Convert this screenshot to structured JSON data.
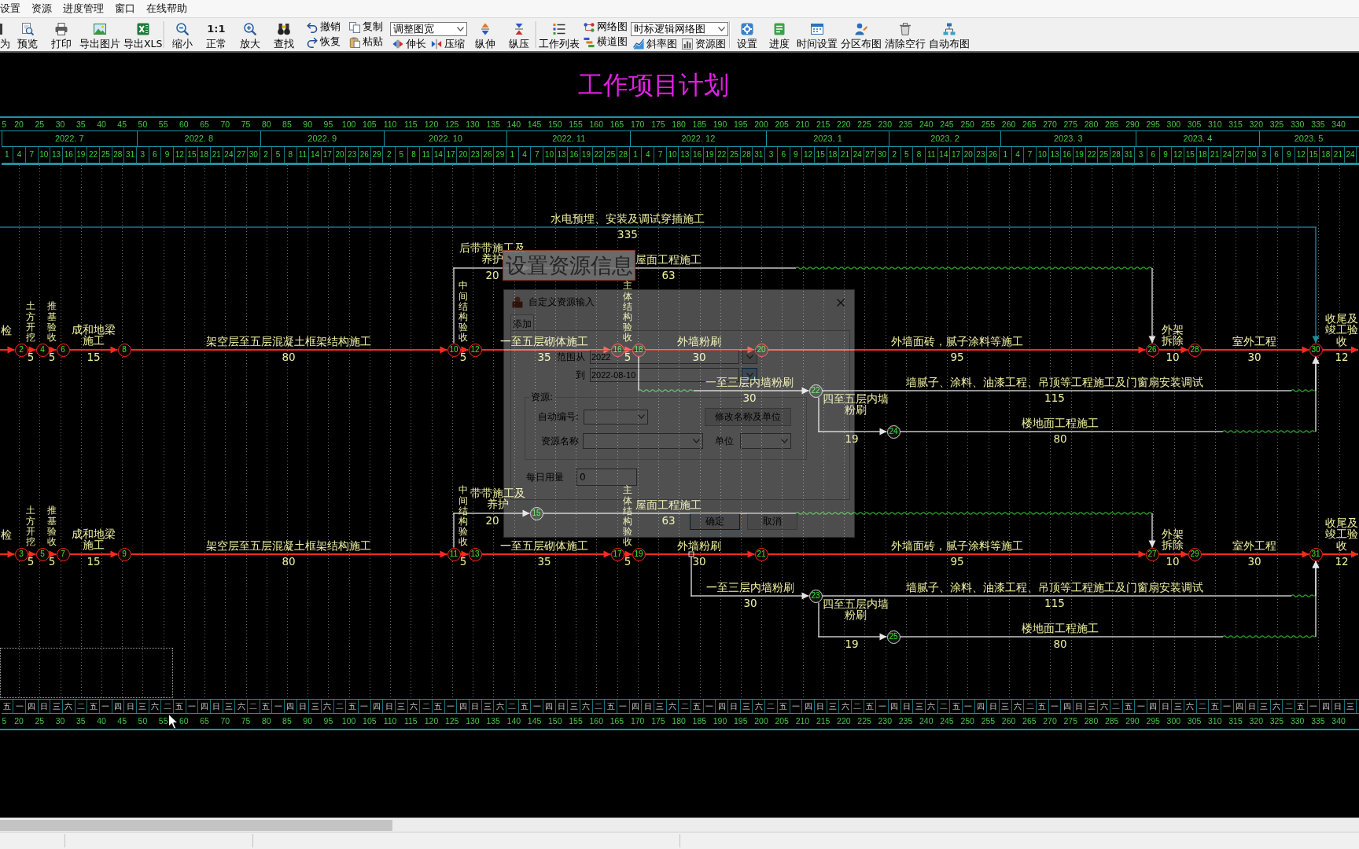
{
  "menu": [
    {
      "label": "设置"
    },
    {
      "label": "资源"
    },
    {
      "label": "进度管理"
    },
    {
      "label": "窗口"
    },
    {
      "label": "在线帮助"
    }
  ],
  "toolbar": [
    {
      "items": [
        {
          "kind": "large",
          "label": "为"
        },
        {
          "kind": "large",
          "label": "预览"
        },
        {
          "kind": "large",
          "label": "打印"
        },
        {
          "kind": "large",
          "label": "导出图片"
        },
        {
          "kind": "large",
          "label": "导出XLS"
        }
      ]
    },
    {
      "items": [
        {
          "kind": "large",
          "label": "缩小"
        },
        {
          "kind": "large",
          "label": "正常",
          "glyph": "1:1"
        },
        {
          "kind": "large",
          "label": "放大"
        },
        {
          "kind": "large",
          "label": "查找"
        },
        {
          "kind": "stack",
          "items": [
            {
              "label": "撤销"
            },
            {
              "label": "恢复"
            }
          ]
        },
        {
          "kind": "stack",
          "items": [
            {
              "label": "复制"
            },
            {
              "label": "粘贴"
            }
          ]
        },
        {
          "kind": "combo",
          "value": "调整图宽",
          "items": [
            {
              "label": "伸长"
            },
            {
              "label": "压缩"
            }
          ]
        },
        {
          "kind": "large",
          "label": "纵伸"
        },
        {
          "kind": "large",
          "label": "纵压"
        }
      ]
    },
    {
      "items": [
        {
          "kind": "large",
          "label": "工作列表"
        },
        {
          "kind": "stack",
          "items": [
            {
              "label": "网络图"
            },
            {
              "label": "横道图"
            }
          ]
        },
        {
          "kind": "combo",
          "value": "时标逻辑网络图",
          "items": [
            {
              "label": "斜率图"
            },
            {
              "label": "资源图"
            }
          ]
        }
      ]
    },
    {
      "items": [
        {
          "kind": "large",
          "label": "设置"
        },
        {
          "kind": "large",
          "label": "进度"
        },
        {
          "kind": "large",
          "label": "时间设置"
        },
        {
          "kind": "large",
          "label": "分区布图"
        },
        {
          "kind": "large",
          "label": "清除空行"
        },
        {
          "kind": "large",
          "label": "自动布图"
        }
      ]
    }
  ],
  "title": "工作项目计划",
  "top_scale": {
    "day_counts": [
      "5",
      "20",
      "25",
      "30",
      "35",
      "40",
      "45",
      "50",
      "55",
      "60",
      "65",
      "70",
      "75",
      "80",
      "85",
      "90",
      "95",
      "100",
      "105",
      "110",
      "115",
      "120",
      "125",
      "130",
      "135",
      "140",
      "145",
      "150",
      "155",
      "160",
      "165",
      "170",
      "175",
      "180",
      "185",
      "190",
      "195",
      "200",
      "205",
      "210",
      "215",
      "220",
      "225",
      "230",
      "235",
      "240",
      "245",
      "250",
      "255",
      "260",
      "265",
      "270",
      "275",
      "280",
      "285",
      "290",
      "295",
      "300",
      "305",
      "310",
      "315",
      "320",
      "325",
      "330",
      "335",
      "340"
    ],
    "months": [
      {
        "label": "2022. 7",
        "days": [
          "1",
          "4",
          "7",
          "10",
          "13",
          "16",
          "19",
          "22",
          "25",
          "28",
          "31"
        ]
      },
      {
        "label": "2022. 8",
        "days": [
          "3",
          "6",
          "9",
          "12",
          "15",
          "18",
          "21",
          "24",
          "27",
          "30"
        ]
      },
      {
        "label": "2022. 9",
        "days": [
          "2",
          "5",
          "8",
          "11",
          "14",
          "17",
          "20",
          "23",
          "26",
          "29"
        ]
      },
      {
        "label": "2022. 10",
        "days": [
          "2",
          "5",
          "8",
          "11",
          "14",
          "17",
          "20",
          "23",
          "26",
          "29"
        ]
      },
      {
        "label": "2022. 11",
        "days": [
          "1",
          "4",
          "7",
          "10",
          "13",
          "16",
          "19",
          "22",
          "25",
          "28"
        ]
      },
      {
        "label": "2022. 12",
        "days": [
          "1",
          "4",
          "7",
          "10",
          "13",
          "16",
          "19",
          "22",
          "25",
          "28",
          "31"
        ]
      },
      {
        "label": "2023. 1",
        "days": [
          "3",
          "6",
          "9",
          "12",
          "15",
          "18",
          "21",
          "24",
          "27",
          "30"
        ]
      },
      {
        "label": "2023. 2",
        "days": [
          "2",
          "5",
          "8",
          "11",
          "14",
          "17",
          "20",
          "23",
          "26"
        ]
      },
      {
        "label": "2023. 3",
        "days": [
          "1",
          "4",
          "7",
          "10",
          "13",
          "16",
          "19",
          "22",
          "25",
          "28",
          "31"
        ]
      },
      {
        "label": "2023. 4",
        "days": [
          "3",
          "6",
          "9",
          "12",
          "15",
          "18",
          "21",
          "24",
          "27",
          "30"
        ]
      },
      {
        "label": "2023. 5",
        "days": [
          "3",
          "6",
          "9",
          "12",
          "15",
          "18",
          "21",
          "24"
        ]
      }
    ]
  },
  "networks": [
    {
      "nodes": [
        {
          "number": "2",
          "critical": true
        },
        {
          "number": "4",
          "critical": true
        },
        {
          "number": "6",
          "critical": true
        },
        {
          "number": "8",
          "critical": true
        },
        {
          "number": "10",
          "critical": true
        },
        {
          "number": "12",
          "critical": true
        },
        {
          "number": "16",
          "critical": true
        },
        {
          "number": "18",
          "critical": true
        },
        {
          "number": "20",
          "critical": true
        },
        {
          "number": "26",
          "critical": true
        },
        {
          "number": "28",
          "critical": true
        },
        {
          "number": "30",
          "critical": true
        },
        {
          "critical": false
        },
        {
          "number": "22",
          "critical": false
        },
        {
          "number": "24",
          "critical": false
        }
      ],
      "activities": [
        {
          "name": "检",
          "kind": "critical"
        },
        {
          "name": "土方开挖",
          "duration": "5",
          "kind": "critical"
        },
        {
          "name": "推基验收",
          "duration": "5",
          "kind": "critical"
        },
        {
          "name": "成和地梁施工",
          "duration": "15",
          "kind": "critical"
        },
        {
          "name": "架空层至五层混凝土框架结构施工",
          "duration": "80",
          "kind": "critical"
        },
        {
          "name": "中间结构验收",
          "duration": "5",
          "kind": "critical"
        },
        {
          "name": "一至五层砌体施工",
          "duration": "35",
          "kind": "critical"
        },
        {
          "name": "主体结构验收",
          "duration": "5",
          "kind": "critical"
        },
        {
          "name": "外墙粉刷",
          "duration": "30",
          "kind": "critical"
        },
        {
          "name": "外墙面砖，腻子涂料等施工",
          "duration": "95",
          "kind": "critical"
        },
        {
          "name": "外架拆除",
          "duration": "10",
          "kind": "critical"
        },
        {
          "name": "室外工程",
          "duration": "30",
          "kind": "critical"
        },
        {
          "name": "收尾及竣工验收",
          "duration": "12",
          "kind": "critical"
        },
        {
          "name": "水电预埋、安装及调试穿插施工",
          "duration": "335",
          "kind": "span"
        },
        {
          "name": "后带带施工及养护",
          "duration": "20",
          "kind": "normal"
        },
        {
          "name": "屋面工程施工",
          "duration": "63",
          "kind": "normal"
        },
        {
          "name": "一至三层内墙粉刷",
          "duration": "30",
          "kind": "normal"
        },
        {
          "name": "墙腻子、涂料、油漆工程、吊顶等工程施工及门窗扇安装调试",
          "duration": "115",
          "kind": "normal"
        },
        {
          "name": "四至五层内墙粉刷",
          "duration": "19",
          "kind": "normal"
        },
        {
          "name": "楼地面工程施工",
          "duration": "80",
          "kind": "normal"
        }
      ]
    },
    {
      "nodes": [
        {
          "number": "3",
          "critical": true
        },
        {
          "number": "5",
          "critical": true
        },
        {
          "number": "7",
          "critical": true
        },
        {
          "number": "9",
          "critical": true
        },
        {
          "number": "11",
          "critical": true
        },
        {
          "number": "13",
          "critical": true
        },
        {
          "number": "17",
          "critical": true
        },
        {
          "number": "19",
          "critical": true
        },
        {
          "number": "21",
          "critical": true
        },
        {
          "number": "27",
          "critical": true
        },
        {
          "number": "29",
          "critical": true
        },
        {
          "number": "31",
          "critical": true
        },
        {
          "number": "15",
          "critical": false
        },
        {
          "number": "23",
          "critical": false
        },
        {
          "number": "25",
          "critical": false
        }
      ],
      "activities": [
        {
          "name": "检",
          "kind": "critical"
        },
        {
          "name": "土方开挖",
          "duration": "5",
          "kind": "critical"
        },
        {
          "name": "推基验收",
          "duration": "5",
          "kind": "critical"
        },
        {
          "name": "成和地梁施工",
          "duration": "15",
          "kind": "critical"
        },
        {
          "name": "架空层至五层混凝土框架结构施工",
          "duration": "80",
          "kind": "critical"
        },
        {
          "name": "中间结构验收",
          "duration": "5",
          "kind": "critical"
        },
        {
          "name": "一至五层砌体施工",
          "duration": "35",
          "kind": "critical"
        },
        {
          "name": "主体结构验收",
          "duration": "5",
          "kind": "critical"
        },
        {
          "name": "外墙粉刷",
          "duration": "30",
          "kind": "critical"
        },
        {
          "name": "外墙面砖，腻子涂料等施工",
          "duration": "95",
          "kind": "critical"
        },
        {
          "name": "外架拆除",
          "duration": "10",
          "kind": "critical"
        },
        {
          "name": "室外工程",
          "duration": "30",
          "kind": "critical"
        },
        {
          "name": "收尾及竣工验收",
          "duration": "12",
          "kind": "critical"
        },
        {
          "name": "带带施工及养护",
          "duration": "20",
          "kind": "normal"
        },
        {
          "name": "屋面工程施工",
          "duration": "63",
          "kind": "normal"
        },
        {
          "name": "一至三层内墙粉刷",
          "duration": "30",
          "kind": "normal"
        },
        {
          "name": "墙腻子、涂料、油漆工程、吊顶等工程施工及门窗扇安装调试",
          "duration": "115",
          "kind": "normal"
        },
        {
          "name": "四至五层内墙粉刷",
          "duration": "19",
          "kind": "normal"
        },
        {
          "name": "楼地面工程施工",
          "duration": "80",
          "kind": "normal"
        }
      ]
    }
  ],
  "banner": "设置资源信息",
  "dialog": {
    "title": "自定义资源输入",
    "tabs": [
      {
        "label": "添加",
        "selected": true
      }
    ],
    "date_range": [
      {
        "label": "范围从",
        "value": "2022",
        "highlighted": false
      },
      {
        "label": "到",
        "value": "2022-08-10",
        "highlighted": true
      }
    ],
    "resource_group": {
      "title": "资源:",
      "auto_number_label": "自动编号:",
      "rename_button": "修改名称及单位",
      "name_label": "资源名称",
      "unit_label": "单位"
    },
    "daily_amount": {
      "label": "每日用量",
      "value": "0"
    },
    "buttons": [
      {
        "label": "确定",
        "default": true
      },
      {
        "label": "取消",
        "default": false
      }
    ]
  },
  "bottom_scale": {
    "weekdays": [
      "五",
      "一",
      "四",
      "日",
      "三",
      "六",
      "二",
      "五",
      "一",
      "四",
      "日",
      "三",
      "六",
      "二",
      "五",
      "一",
      "四",
      "日",
      "三",
      "六",
      "二",
      "五",
      "一",
      "四",
      "日",
      "三",
      "六",
      "二",
      "五",
      "一",
      "四",
      "日",
      "三",
      "六",
      "二",
      "五",
      "一",
      "四",
      "日",
      "三",
      "六",
      "二",
      "五",
      "一",
      "四",
      "日",
      "三",
      "六",
      "二",
      "五",
      "一",
      "四",
      "日",
      "三",
      "六",
      "二",
      "五",
      "一",
      "四",
      "日",
      "三",
      "六",
      "二",
      "五",
      "一",
      "四",
      "日",
      "三",
      "六",
      "二",
      "五",
      "一",
      "四",
      "日",
      "三",
      "六",
      "二",
      "五",
      "一",
      "四",
      "日",
      "三",
      "六",
      "二",
      "五",
      "一",
      "四",
      "日",
      "三",
      "六",
      "二",
      "五",
      "一",
      "四",
      "日",
      "三",
      "六",
      "二",
      "五",
      "一",
      "四",
      "日",
      "三",
      "六",
      "二",
      "五",
      "一",
      "四",
      "日",
      "三"
    ],
    "day_counts": [
      "5",
      "20",
      "25",
      "30",
      "35",
      "40",
      "45",
      "50",
      "55",
      "60",
      "65",
      "70",
      "75",
      "80",
      "85",
      "90",
      "95",
      "100",
      "105",
      "110",
      "115",
      "120",
      "125",
      "130",
      "135",
      "140",
      "145",
      "150",
      "155",
      "160",
      "165",
      "170",
      "175",
      "180",
      "185",
      "190",
      "195",
      "200",
      "205",
      "210",
      "215",
      "220",
      "225",
      "230",
      "235",
      "240",
      "245",
      "250",
      "255",
      "260",
      "265",
      "270",
      "275",
      "280",
      "285",
      "290",
      "295",
      "300",
      "305",
      "310",
      "315",
      "320",
      "325",
      "330",
      "335",
      "340"
    ]
  }
}
